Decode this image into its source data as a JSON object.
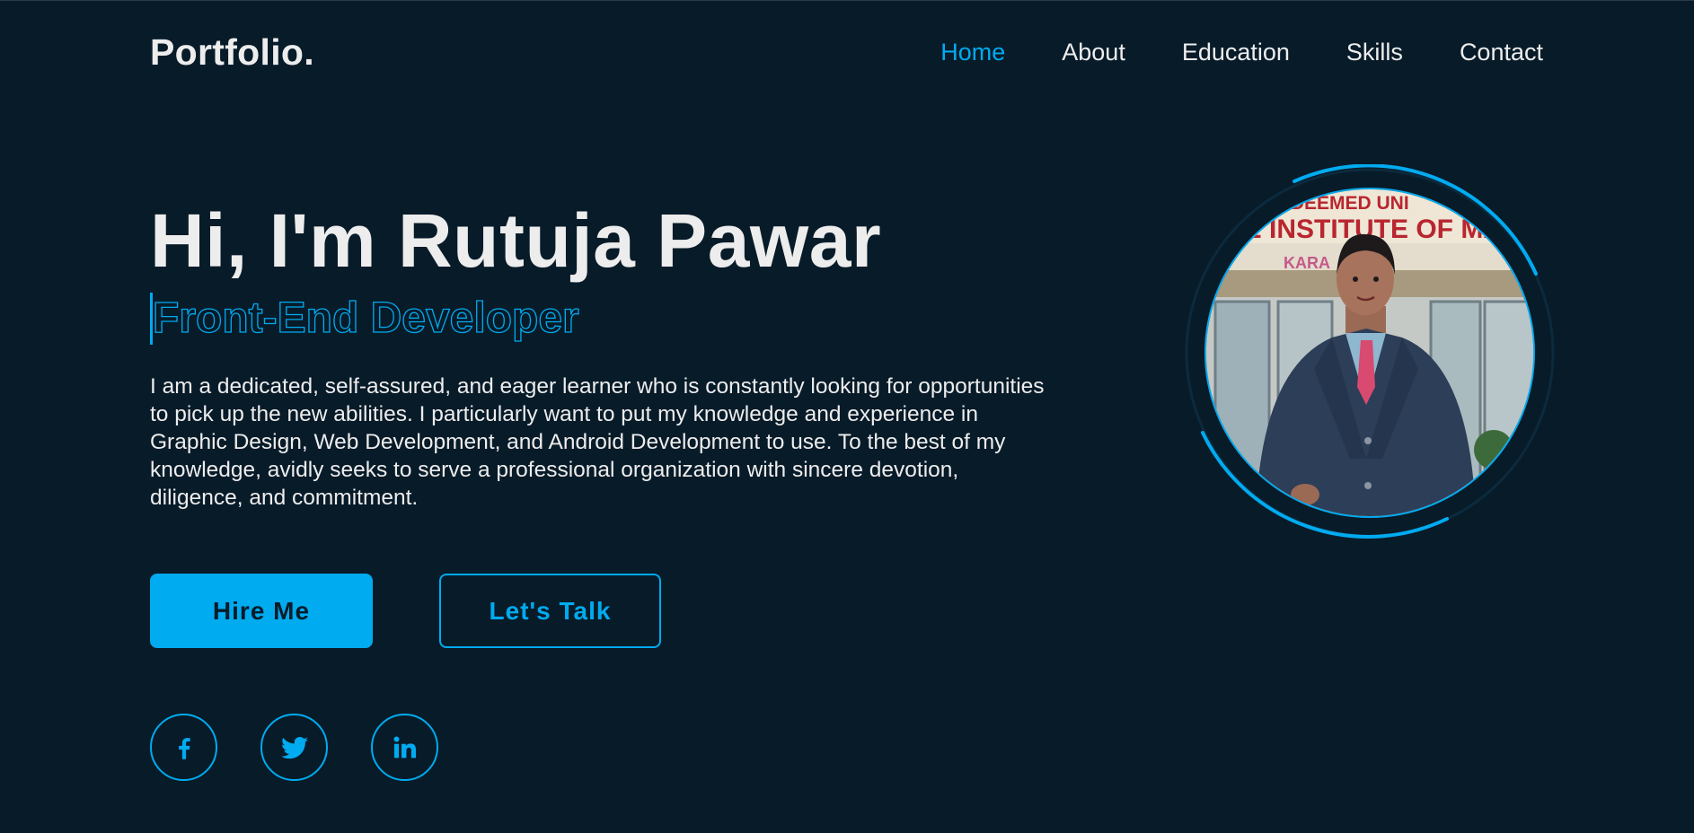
{
  "header": {
    "logo": "Portfolio.",
    "nav": [
      {
        "label": "Home",
        "active": true
      },
      {
        "label": "About"
      },
      {
        "label": "Education"
      },
      {
        "label": "Skills"
      },
      {
        "label": "Contact"
      }
    ]
  },
  "hero": {
    "greeting": "Hi, I'm Rutuja Pawar",
    "role": "Front-End Developer",
    "bio": "I am a dedicated, self-assured, and eager learner who is constantly looking for opportunities to pick up the new abilities. I particularly want to put my knowledge and experience in Graphic Design, Web Development, and Android Development to use. To the best of my knowledge, avidly seeks to serve a professional organization with sincere devotion, diligence, and commitment."
  },
  "buttons": {
    "hire": "Hire Me",
    "talk": "Let's Talk"
  },
  "social": [
    {
      "icon": "facebook-icon"
    },
    {
      "icon": "twitter-icon"
    },
    {
      "icon": "linkedin-icon"
    }
  ],
  "photo": {
    "sign_line1": "TH DEEMED UNI",
    "sign_line2": "ITE INSTITUTE OF MA",
    "sign_line3": "KARA"
  },
  "colors": {
    "background": "#081b29",
    "accent": "#00abf0",
    "text": "#ededed"
  }
}
